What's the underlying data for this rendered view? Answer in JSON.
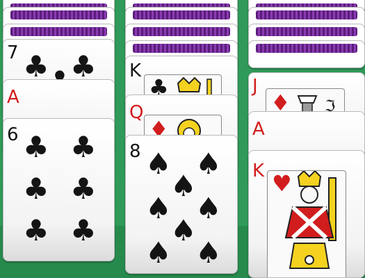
{
  "game": "solitaire",
  "colors": {
    "felt": "#2f9a59",
    "card_back": "#6b2a8f",
    "red_suit": "#d11d1d",
    "black_suit": "#141414"
  },
  "columns": [
    {
      "facedown_count": 3,
      "cards": [
        {
          "rank": "7",
          "suit": "♣",
          "color": "black"
        },
        {
          "rank": "A",
          "suit": "",
          "color": "red"
        },
        {
          "rank": "6",
          "suit": "♣",
          "color": "black"
        }
      ]
    },
    {
      "facedown_count": 4,
      "cards": [
        {
          "rank": "K",
          "suit": "♣",
          "color": "black"
        },
        {
          "rank": "Q",
          "suit": "♦",
          "color": "red"
        },
        {
          "rank": "8",
          "suit": "♠",
          "color": "black"
        }
      ]
    },
    {
      "facedown_count": 4,
      "cards": [
        {
          "rank": "J",
          "suit": "♦",
          "color": "red"
        },
        {
          "rank": "A",
          "suit": "",
          "color": "red"
        },
        {
          "rank": "K",
          "suit": "♥",
          "color": "red"
        }
      ]
    }
  ]
}
